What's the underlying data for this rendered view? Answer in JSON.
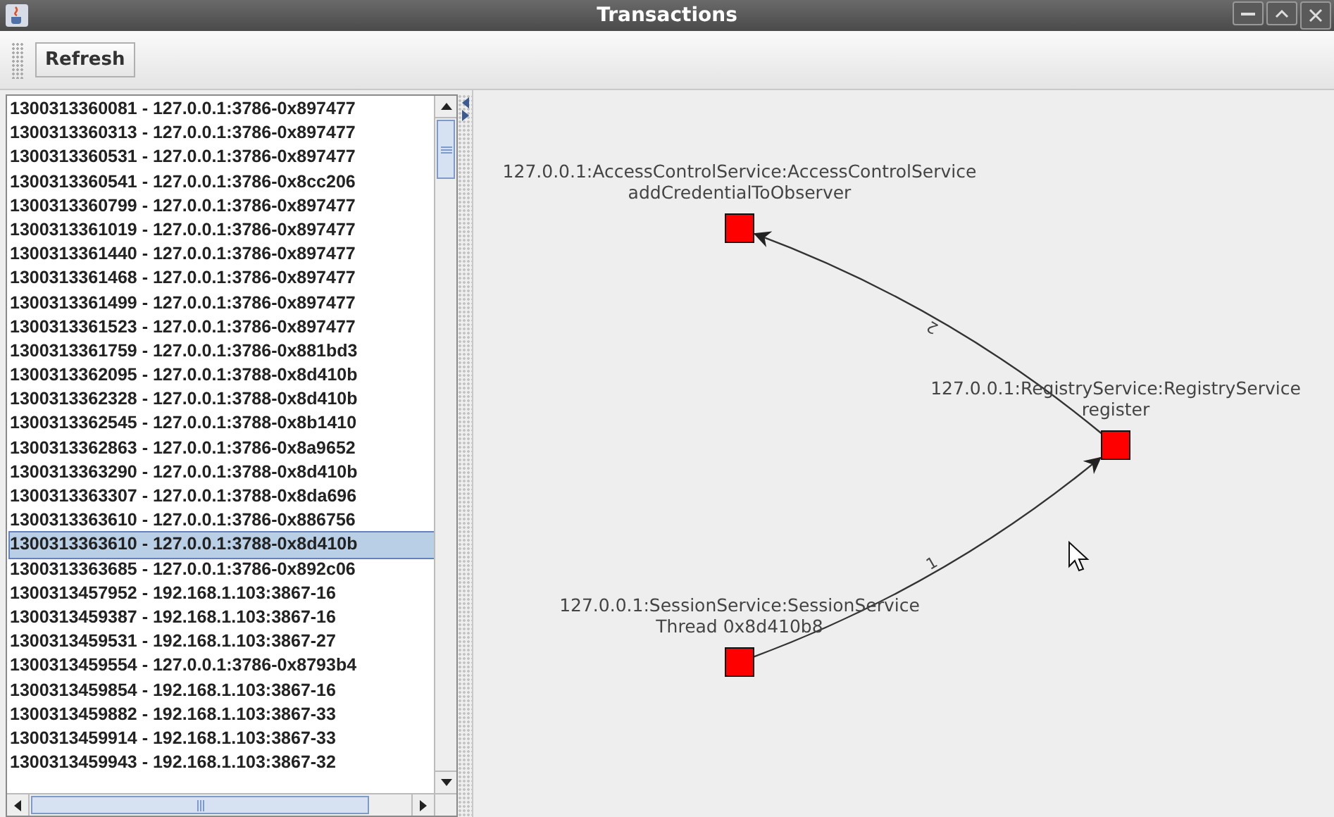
{
  "window": {
    "title": "Transactions"
  },
  "toolbar": {
    "buttons": [
      "Refresh"
    ]
  },
  "transactions": [
    {
      "text": "1300313360081 - 127.0.0.1:3786-0x897477",
      "selected": false
    },
    {
      "text": "1300313360313 - 127.0.0.1:3786-0x897477",
      "selected": false
    },
    {
      "text": "1300313360531 - 127.0.0.1:3786-0x897477",
      "selected": false
    },
    {
      "text": "1300313360541 - 127.0.0.1:3786-0x8cc206",
      "selected": false
    },
    {
      "text": "1300313360799 - 127.0.0.1:3786-0x897477",
      "selected": false
    },
    {
      "text": "1300313361019 - 127.0.0.1:3786-0x897477",
      "selected": false
    },
    {
      "text": "1300313361440 - 127.0.0.1:3786-0x897477",
      "selected": false
    },
    {
      "text": "1300313361468 - 127.0.0.1:3786-0x897477",
      "selected": false
    },
    {
      "text": "1300313361499 - 127.0.0.1:3786-0x897477",
      "selected": false
    },
    {
      "text": "1300313361523 - 127.0.0.1:3786-0x897477",
      "selected": false
    },
    {
      "text": "1300313361759 - 127.0.0.1:3786-0x881bd3",
      "selected": false
    },
    {
      "text": "1300313362095 - 127.0.0.1:3788-0x8d410b",
      "selected": false
    },
    {
      "text": "1300313362328 - 127.0.0.1:3788-0x8d410b",
      "selected": false
    },
    {
      "text": "1300313362545 - 127.0.0.1:3788-0x8b1410",
      "selected": false
    },
    {
      "text": "1300313362863 - 127.0.0.1:3786-0x8a9652",
      "selected": false
    },
    {
      "text": "1300313363290 - 127.0.0.1:3788-0x8d410b",
      "selected": false
    },
    {
      "text": "1300313363307 - 127.0.0.1:3788-0x8da696",
      "selected": false
    },
    {
      "text": "1300313363610 - 127.0.0.1:3786-0x886756",
      "selected": false
    },
    {
      "text": "1300313363610 - 127.0.0.1:3788-0x8d410b",
      "selected": true
    },
    {
      "text": "1300313363685 - 127.0.0.1:3786-0x892c06",
      "selected": false
    },
    {
      "text": "1300313457952 - 192.168.1.103:3867-16",
      "selected": false
    },
    {
      "text": "1300313459387 - 192.168.1.103:3867-16",
      "selected": false
    },
    {
      "text": "1300313459531 - 192.168.1.103:3867-27",
      "selected": false
    },
    {
      "text": "1300313459554 - 127.0.0.1:3786-0x8793b4",
      "selected": false
    },
    {
      "text": "1300313459854 - 192.168.1.103:3867-16",
      "selected": false
    },
    {
      "text": "1300313459882 - 192.168.1.103:3867-33",
      "selected": false
    },
    {
      "text": "1300313459914 - 192.168.1.103:3867-33",
      "selected": false
    },
    {
      "text": "1300313459943 - 192.168.1.103:3867-32",
      "selected": false
    }
  ],
  "graph": {
    "nodes": [
      {
        "lines": [
          "127.0.0.1:AccessControlService:AccessControlService",
          "addCredentialToObserver"
        ]
      },
      {
        "lines": [
          "127.0.0.1:RegistryService:RegistryService",
          "register"
        ]
      },
      {
        "lines": [
          "127.0.0.1:SessionService:SessionService",
          "Thread 0x8d410b8"
        ]
      }
    ],
    "edges": [
      {
        "label": "2"
      },
      {
        "label": "1"
      }
    ]
  }
}
